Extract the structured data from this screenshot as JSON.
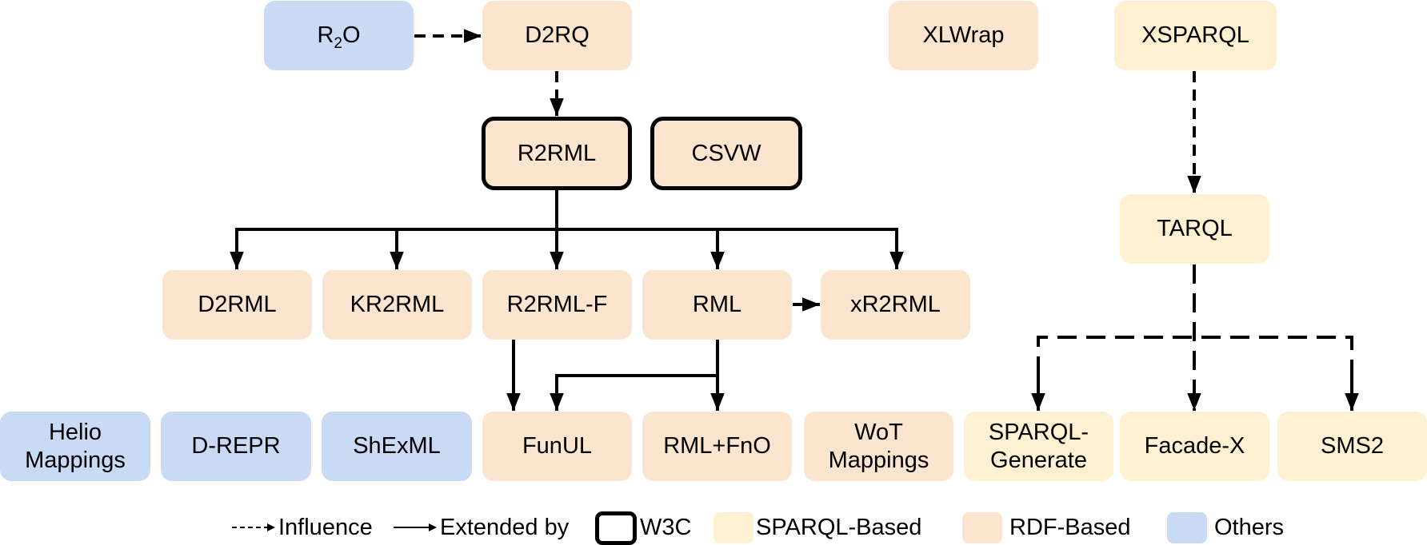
{
  "colors": {
    "sparql_based": "#fef1d2",
    "rdf_based": "#fbe5cf",
    "others": "#c9daf5",
    "edge": "#000000"
  },
  "nodes": {
    "r2o": {
      "label_main": "R",
      "label_sub": "2",
      "label_tail": "O",
      "category": "others"
    },
    "d2rq": {
      "label": "D2RQ",
      "category": "rdf_based"
    },
    "xlwrap": {
      "label": "XLWrap",
      "category": "rdf_based"
    },
    "xsparql": {
      "label": "XSPARQL",
      "category": "sparql_based"
    },
    "r2rml": {
      "label": "R2RML",
      "category": "rdf_based",
      "w3c": true
    },
    "csvw": {
      "label": "CSVW",
      "category": "rdf_based",
      "w3c": true
    },
    "tarql": {
      "label": "TARQL",
      "category": "sparql_based"
    },
    "d2rml": {
      "label": "D2RML",
      "category": "rdf_based"
    },
    "kr2rml": {
      "label": "KR2RML",
      "category": "rdf_based"
    },
    "r2rml_f": {
      "label": "R2RML-F",
      "category": "rdf_based"
    },
    "rml": {
      "label": "RML",
      "category": "rdf_based"
    },
    "xr2rml": {
      "label": "xR2RML",
      "category": "rdf_based"
    },
    "helio": {
      "label_line1": "Helio",
      "label_line2": "Mappings",
      "category": "others"
    },
    "d_repr": {
      "label": "D-REPR",
      "category": "others"
    },
    "shexml": {
      "label": "ShExML",
      "category": "others"
    },
    "funul": {
      "label": "FunUL",
      "category": "rdf_based"
    },
    "rml_fno": {
      "label": "RML+FnO",
      "category": "rdf_based"
    },
    "wot": {
      "label_line1": "WoT",
      "label_line2": "Mappings",
      "category": "rdf_based"
    },
    "sparql_generate": {
      "label_line1": "SPARQL-",
      "label_line2": "Generate",
      "category": "sparql_based"
    },
    "facade_x": {
      "label": "Facade-X",
      "category": "sparql_based"
    },
    "sms2": {
      "label": "SMS2",
      "category": "sparql_based"
    }
  },
  "edges": [
    {
      "from": "R2O",
      "to": "D2RQ",
      "type": "influence"
    },
    {
      "from": "D2RQ",
      "to": "R2RML",
      "type": "influence"
    },
    {
      "from": "R2RML",
      "to": "D2RML",
      "type": "extended_by"
    },
    {
      "from": "R2RML",
      "to": "KR2RML",
      "type": "extended_by"
    },
    {
      "from": "R2RML",
      "to": "R2RML-F",
      "type": "extended_by"
    },
    {
      "from": "R2RML",
      "to": "RML",
      "type": "extended_by"
    },
    {
      "from": "R2RML",
      "to": "xR2RML",
      "type": "extended_by"
    },
    {
      "from": "RML",
      "to": "xR2RML",
      "type": "extended_by"
    },
    {
      "from": "R2RML-F",
      "to": "FunUL",
      "type": "extended_by"
    },
    {
      "from": "RML",
      "to": "FunUL",
      "type": "extended_by"
    },
    {
      "from": "RML",
      "to": "RML+FnO",
      "type": "extended_by"
    },
    {
      "from": "XSPARQL",
      "to": "TARQL",
      "type": "influence"
    },
    {
      "from": "TARQL",
      "to": "SPARQL-Generate",
      "type": "influence"
    },
    {
      "from": "TARQL",
      "to": "Facade-X",
      "type": "influence"
    },
    {
      "from": "TARQL",
      "to": "SMS2",
      "type": "influence"
    }
  ],
  "legend": {
    "influence": "Influence",
    "extended_by": "Extended by",
    "w3c": "W3C",
    "sparql_based": "SPARQL-Based",
    "rdf_based": "RDF-Based",
    "others": "Others"
  }
}
